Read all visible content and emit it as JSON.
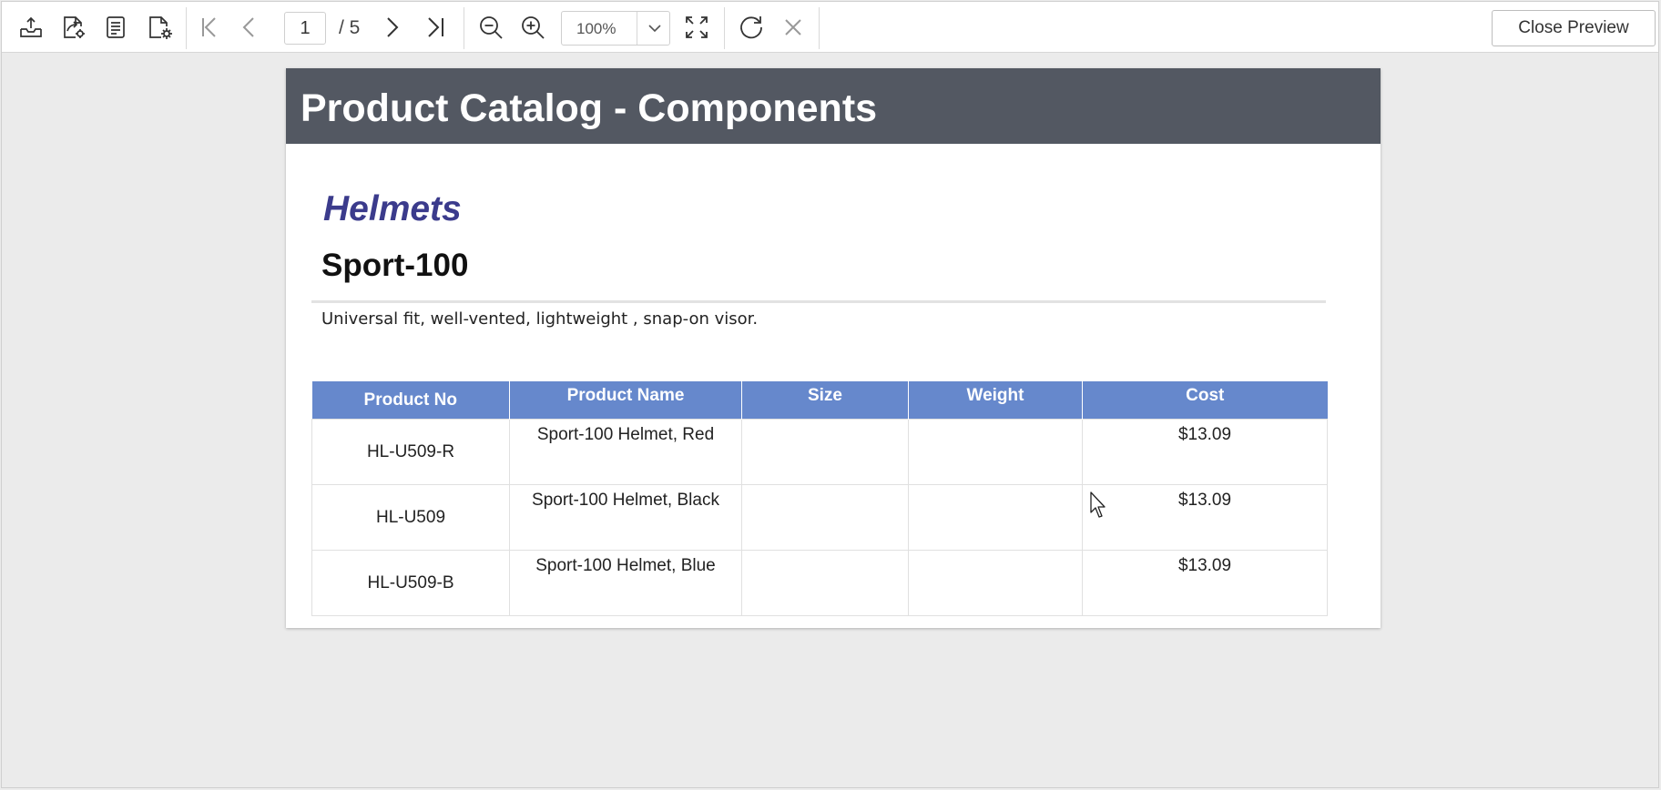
{
  "toolbar": {
    "icons": {
      "export": "export-icon",
      "print": "print-icon",
      "parameters": "parameters-icon",
      "page_setup": "page-setup-icon",
      "first_page": "first-page-icon",
      "previous_page": "previous-page-icon",
      "next_page": "next-page-icon",
      "last_page": "last-page-icon",
      "zoom_out": "zoom-out-icon",
      "zoom_in": "zoom-in-icon",
      "fit_page": "fit-page-icon",
      "refresh": "refresh-icon",
      "stop": "close-icon"
    },
    "page_number": "1",
    "page_total": "/ 5",
    "zoom_level": "100%",
    "close_preview_label": "Close Preview"
  },
  "report": {
    "title": "Product Catalog - Components",
    "category": "Helmets",
    "product": "Sport-100",
    "description": "Universal fit, well-vented, lightweight , snap-on visor.",
    "table": {
      "headers": [
        "Product No",
        "Product Name",
        "Size",
        "Weight",
        "Cost"
      ],
      "rows": [
        {
          "product_no": "HL-U509-R",
          "product_name": "Sport-100 Helmet, Red",
          "size": "",
          "weight": "",
          "cost": "$13.09"
        },
        {
          "product_no": "HL-U509",
          "product_name": "Sport-100 Helmet, Black",
          "size": "",
          "weight": "",
          "cost": "$13.09"
        },
        {
          "product_no": "HL-U509-B",
          "product_name": "Sport-100 Helmet, Blue",
          "size": "",
          "weight": "",
          "cost": "$13.09"
        }
      ]
    }
  },
  "colors": {
    "header_bar": "#535862",
    "table_header": "#6688cc",
    "category_text": "#3b3b8c",
    "workspace": "#ebebeb"
  }
}
